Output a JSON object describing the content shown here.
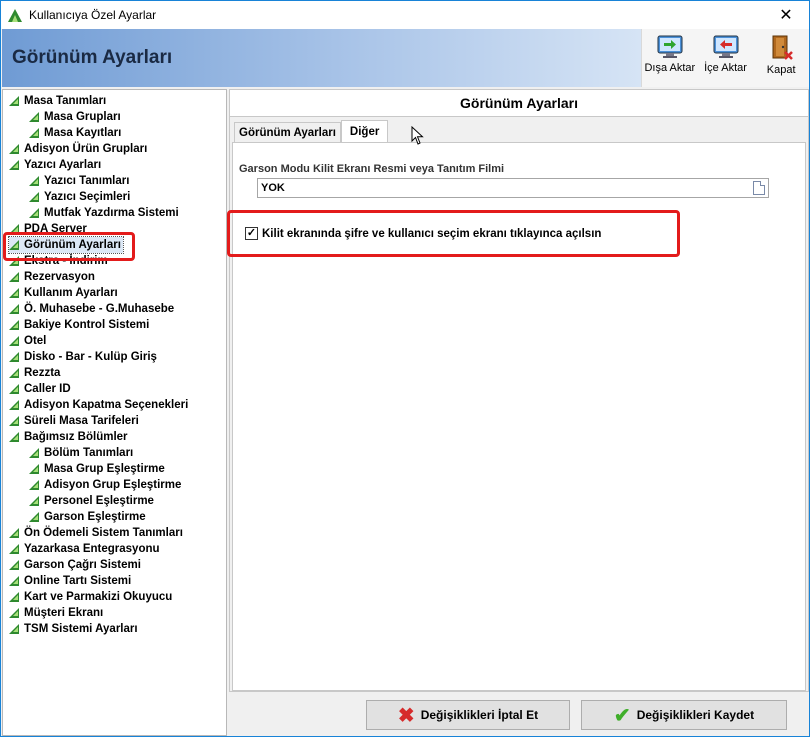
{
  "window": {
    "title": "Kullanıcıya Özel Ayarlar",
    "close_glyph": "✕"
  },
  "banner": {
    "heading": "Görünüm Ayarları"
  },
  "toolbar": {
    "export_label": "Dışa Aktar",
    "import_label": "İçe Aktar",
    "close_label": "Kapat"
  },
  "tree": {
    "items": [
      {
        "label": "Masa Tanımları",
        "level": 0
      },
      {
        "label": "Masa Grupları",
        "level": 1
      },
      {
        "label": "Masa Kayıtları",
        "level": 1
      },
      {
        "label": "Adisyon Ürün Grupları",
        "level": 0
      },
      {
        "label": "Yazıcı Ayarları",
        "level": 0
      },
      {
        "label": "Yazıcı Tanımları",
        "level": 1
      },
      {
        "label": "Yazıcı Seçimleri",
        "level": 1
      },
      {
        "label": "Mutfak Yazdırma Sistemi",
        "level": 1
      },
      {
        "label": "PDA Server",
        "level": 0
      },
      {
        "label": "Görünüm Ayarları",
        "level": 0,
        "selected": true
      },
      {
        "label": "Ekstra - İndirim",
        "level": 0
      },
      {
        "label": "Rezervasyon",
        "level": 0
      },
      {
        "label": "Kullanım Ayarları",
        "level": 0
      },
      {
        "label": "Ö. Muhasebe - G.Muhasebe",
        "level": 0
      },
      {
        "label": "Bakiye Kontrol Sistemi",
        "level": 0
      },
      {
        "label": "Otel",
        "level": 0
      },
      {
        "label": "Disko - Bar - Kulüp Giriş",
        "level": 0
      },
      {
        "label": "Rezzta",
        "level": 0
      },
      {
        "label": "Caller ID",
        "level": 0
      },
      {
        "label": "Adisyon Kapatma Seçenekleri",
        "level": 0
      },
      {
        "label": "Süreli Masa Tarifeleri",
        "level": 0
      },
      {
        "label": "Bağımsız Bölümler",
        "level": 0
      },
      {
        "label": "Bölüm Tanımları",
        "level": 1
      },
      {
        "label": "Masa Grup Eşleştirme",
        "level": 1
      },
      {
        "label": "Adisyon Grup Eşleştirme",
        "level": 1
      },
      {
        "label": "Personel Eşleştirme",
        "level": 1
      },
      {
        "label": "Garson Eşleştirme",
        "level": 1
      },
      {
        "label": "Ön Ödemeli Sistem Tanımları",
        "level": 0
      },
      {
        "label": "Yazarkasa Entegrasyonu",
        "level": 0
      },
      {
        "label": "Garson Çağrı Sistemi",
        "level": 0
      },
      {
        "label": "Online Tartı Sistemi",
        "level": 0
      },
      {
        "label": "Kart ve Parmakizi Okuyucu",
        "level": 0
      },
      {
        "label": "Müşteri Ekranı",
        "level": 0
      },
      {
        "label": "TSM Sistemi Ayarları",
        "level": 0
      }
    ]
  },
  "content": {
    "title": "Görünüm Ayarları",
    "tabs": [
      {
        "label": "Görünüm Ayarları",
        "active": false
      },
      {
        "label": "Diğer",
        "active": true
      }
    ],
    "group_label": "Garson Modu Kilit Ekranı Resmi veya Tanıtım Filmi",
    "field_value": "YOK",
    "checkbox_label": "Kilit ekranında şifre ve kullanıcı seçim ekranı tıklayınca açılsın",
    "checkbox_checked": true,
    "checkbox_glyph": "✓"
  },
  "buttons": {
    "cancel_label": "Değişiklikleri İptal Et",
    "save_label": "Değişiklikleri Kaydet"
  },
  "colors": {
    "highlight": "#e31b1b",
    "accent": "#1883d7"
  }
}
